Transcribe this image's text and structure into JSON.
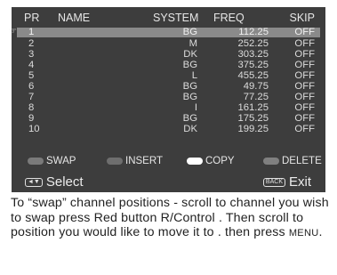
{
  "columns": {
    "pr": "PR",
    "name": "NAME",
    "system": "SYSTEM",
    "freq": "FREQ",
    "skip": "SKIP"
  },
  "rows": [
    {
      "pr": "1",
      "system": "BG",
      "freq": "112.25",
      "skip": "OFF"
    },
    {
      "pr": "2",
      "system": "M",
      "freq": "252.25",
      "skip": "OFF"
    },
    {
      "pr": "3",
      "system": "DK",
      "freq": "303.25",
      "skip": "OFF"
    },
    {
      "pr": "4",
      "system": "BG",
      "freq": "375.25",
      "skip": "OFF"
    },
    {
      "pr": "5",
      "system": "L",
      "freq": "455.25",
      "skip": "OFF"
    },
    {
      "pr": "6",
      "system": "BG",
      "freq": "49.75",
      "skip": "OFF"
    },
    {
      "pr": "7",
      "system": "BG",
      "freq": "77.25",
      "skip": "OFF"
    },
    {
      "pr": "8",
      "system": "I",
      "freq": "161.25",
      "skip": "OFF"
    },
    {
      "pr": "9",
      "system": "BG",
      "freq": "175.25",
      "skip": "OFF"
    },
    {
      "pr": "10",
      "system": "DK",
      "freq": "199.25",
      "skip": "OFF"
    }
  ],
  "legend": {
    "swap": {
      "label": "SWAP",
      "color": "#7a7a7a"
    },
    "insert": {
      "label": "INSERT",
      "color": "#6e6e6e"
    },
    "copy": {
      "label": "COPY",
      "color": "#ffffff"
    },
    "delete": {
      "label": "DELETE",
      "color": "#808080"
    }
  },
  "footer": {
    "select_key": "◄▼",
    "select_label": "Select",
    "exit_key": "BACK",
    "exit_label": "Exit"
  },
  "caption": {
    "text_1": "To “swap” channel positions - scroll to channel you wish to swap press Red button R/Control . Then scroll to position you would like to move it to . then press ",
    "menu": "MENU",
    "text_2": "."
  }
}
